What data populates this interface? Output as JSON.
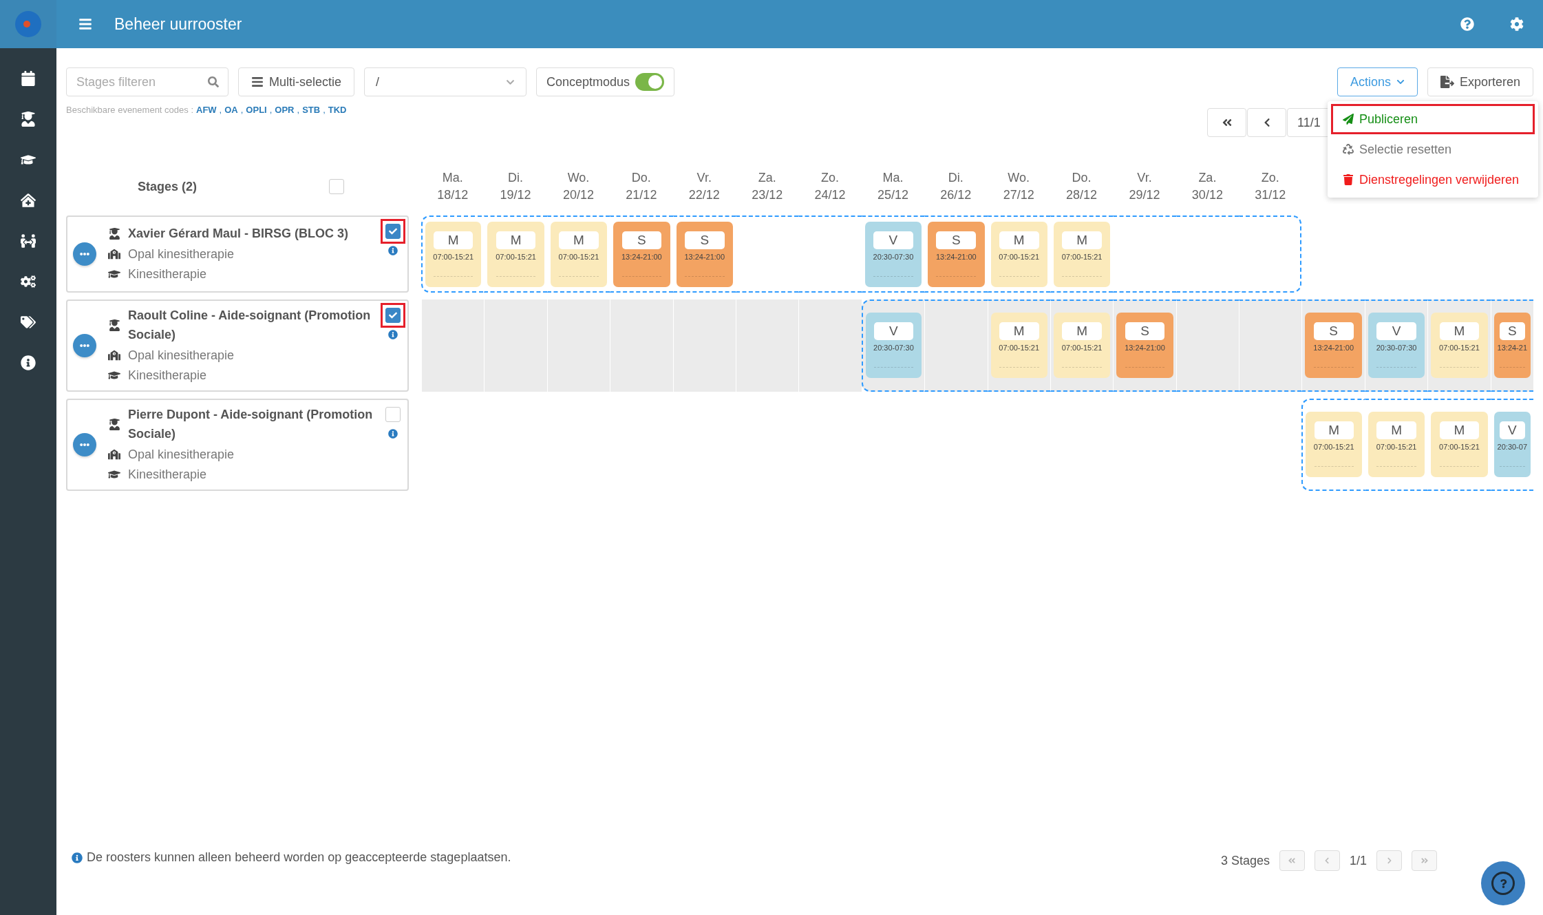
{
  "header": {
    "title": "Beheer uurrooster"
  },
  "toolbar": {
    "filter_placeholder": "Stages filteren",
    "multi_select": "Multi-selectie",
    "dropdown_value": "/",
    "concept_label": "Conceptmodus",
    "concept_on": true,
    "actions": "Actions",
    "export": "Exporteren"
  },
  "event_codes": {
    "label": "Beschikbare evenement codes :",
    "separator": ",",
    "codes": [
      "AFW",
      "OA",
      "OPLI",
      "OPR",
      "STB",
      "TKD"
    ]
  },
  "period_nav": {
    "current": "11/1"
  },
  "actions_menu": {
    "items": [
      {
        "kind": "publish",
        "label": "Publiceren",
        "annotated": true
      },
      {
        "kind": "reset",
        "label": "Selectie resetten",
        "annotated": false
      },
      {
        "kind": "delete",
        "label": "Dienstregelingen verwijderen",
        "annotated": false
      }
    ]
  },
  "stages_heading": "Stages (2)",
  "select_all_checked": false,
  "days": [
    {
      "day": "Ma.",
      "date": "18/12"
    },
    {
      "day": "Di.",
      "date": "19/12"
    },
    {
      "day": "Wo.",
      "date": "20/12"
    },
    {
      "day": "Do.",
      "date": "21/12"
    },
    {
      "day": "Vr.",
      "date": "22/12"
    },
    {
      "day": "Za.",
      "date": "23/12"
    },
    {
      "day": "Zo.",
      "date": "24/12"
    },
    {
      "day": "Ma.",
      "date": "25/12"
    },
    {
      "day": "Di.",
      "date": "26/12"
    },
    {
      "day": "Wo.",
      "date": "27/12"
    },
    {
      "day": "Do.",
      "date": "28/12"
    },
    {
      "day": "Vr.",
      "date": "29/12"
    },
    {
      "day": "Za.",
      "date": "30/12"
    },
    {
      "day": "Zo.",
      "date": "31/12"
    }
  ],
  "rows": [
    {
      "title": "Xavier Gérard Maul - BIRSG (BLOC 3)",
      "place": "Opal kinesitherapie",
      "program": "Kinesitherapie",
      "checked": true,
      "annotated": true,
      "shaded": false,
      "cells": [
        {
          "selected": true,
          "shift": {
            "code": "M",
            "time": "07:00-15:21",
            "color": "#fbeabb"
          }
        },
        {
          "selected": true,
          "shift": {
            "code": "M",
            "time": "07:00-15:21",
            "color": "#fbeabb"
          }
        },
        {
          "selected": true,
          "shift": {
            "code": "M",
            "time": "07:00-15:21",
            "color": "#fbeabb"
          }
        },
        {
          "selected": true,
          "shift": {
            "code": "S",
            "time": "13:24-21:00",
            "color": "#f3a362"
          }
        },
        {
          "selected": true,
          "shift": {
            "code": "S",
            "time": "13:24-21:00",
            "color": "#f3a362"
          }
        },
        {
          "selected": true
        },
        {
          "selected": true
        },
        {
          "selected": true,
          "shift": {
            "code": "V",
            "time": "20:30-07:30",
            "color": "#add8e6"
          }
        },
        {
          "selected": true,
          "shift": {
            "code": "S",
            "time": "13:24-21:00",
            "color": "#f3a362"
          }
        },
        {
          "selected": true,
          "shift": {
            "code": "M",
            "time": "07:00-15:21",
            "color": "#fbeabb"
          }
        },
        {
          "selected": true,
          "shift": {
            "code": "M",
            "time": "07:00-15:21",
            "color": "#fbeabb"
          }
        },
        {
          "selected": true
        },
        {
          "selected": true
        },
        {
          "selected": true
        },
        {
          "selected": false
        },
        {
          "selected": false
        },
        {
          "selected": false
        },
        {
          "selected": false
        }
      ]
    },
    {
      "title": "Raoult Coline - Aide-soignant (Promotion Sociale)",
      "place": "Opal kinesitherapie",
      "program": "Kinesitherapie",
      "checked": true,
      "annotated": true,
      "shaded": true,
      "cells": [
        {
          "selected": false
        },
        {
          "selected": false
        },
        {
          "selected": false
        },
        {
          "selected": false
        },
        {
          "selected": false
        },
        {
          "selected": false
        },
        {
          "selected": false
        },
        {
          "selected": true,
          "shift": {
            "code": "V",
            "time": "20:30-07:30",
            "color": "#add8e6"
          }
        },
        {
          "selected": true
        },
        {
          "selected": true,
          "shift": {
            "code": "M",
            "time": "07:00-15:21",
            "color": "#fbeabb"
          }
        },
        {
          "selected": true,
          "shift": {
            "code": "M",
            "time": "07:00-15:21",
            "color": "#fbeabb"
          }
        },
        {
          "selected": true,
          "shift": {
            "code": "S",
            "time": "13:24-21:00",
            "color": "#f3a362"
          }
        },
        {
          "selected": true
        },
        {
          "selected": true
        },
        {
          "selected": true,
          "shift": {
            "code": "S",
            "time": "13:24-21:00",
            "color": "#f3a362"
          }
        },
        {
          "selected": true,
          "shift": {
            "code": "V",
            "time": "20:30-07:30",
            "color": "#add8e6"
          }
        },
        {
          "selected": true,
          "shift": {
            "code": "M",
            "time": "07:00-15:21",
            "color": "#fbeabb"
          }
        },
        {
          "selected": true,
          "shift": {
            "code": "S",
            "time": "13:24-21",
            "color": "#f3a362"
          }
        }
      ]
    },
    {
      "title": "Pierre Dupont - Aide-soignant (Promotion Sociale)",
      "place": "Opal kinesitherapie",
      "program": "Kinesitherapie",
      "checked": false,
      "annotated": false,
      "shaded": false,
      "cells": [
        {
          "selected": false
        },
        {
          "selected": false
        },
        {
          "selected": false
        },
        {
          "selected": false
        },
        {
          "selected": false
        },
        {
          "selected": false
        },
        {
          "selected": false
        },
        {
          "selected": false
        },
        {
          "selected": false
        },
        {
          "selected": false
        },
        {
          "selected": false
        },
        {
          "selected": false
        },
        {
          "selected": false
        },
        {
          "selected": false
        },
        {
          "selected": true,
          "shift": {
            "code": "M",
            "time": "07:00-15:21",
            "color": "#fbeabb"
          }
        },
        {
          "selected": true,
          "shift": {
            "code": "M",
            "time": "07:00-15:21",
            "color": "#fbeabb"
          }
        },
        {
          "selected": true,
          "shift": {
            "code": "M",
            "time": "07:00-15:21",
            "color": "#fbeabb"
          }
        },
        {
          "selected": true,
          "shift": {
            "code": "V",
            "time": "20:30-07",
            "color": "#add8e6"
          }
        }
      ]
    }
  ],
  "footer": {
    "note": "De roosters kunnen alleen beheerd worden op geaccepteerde stageplaatsen.",
    "count": "3 Stages",
    "page": "1/1"
  }
}
